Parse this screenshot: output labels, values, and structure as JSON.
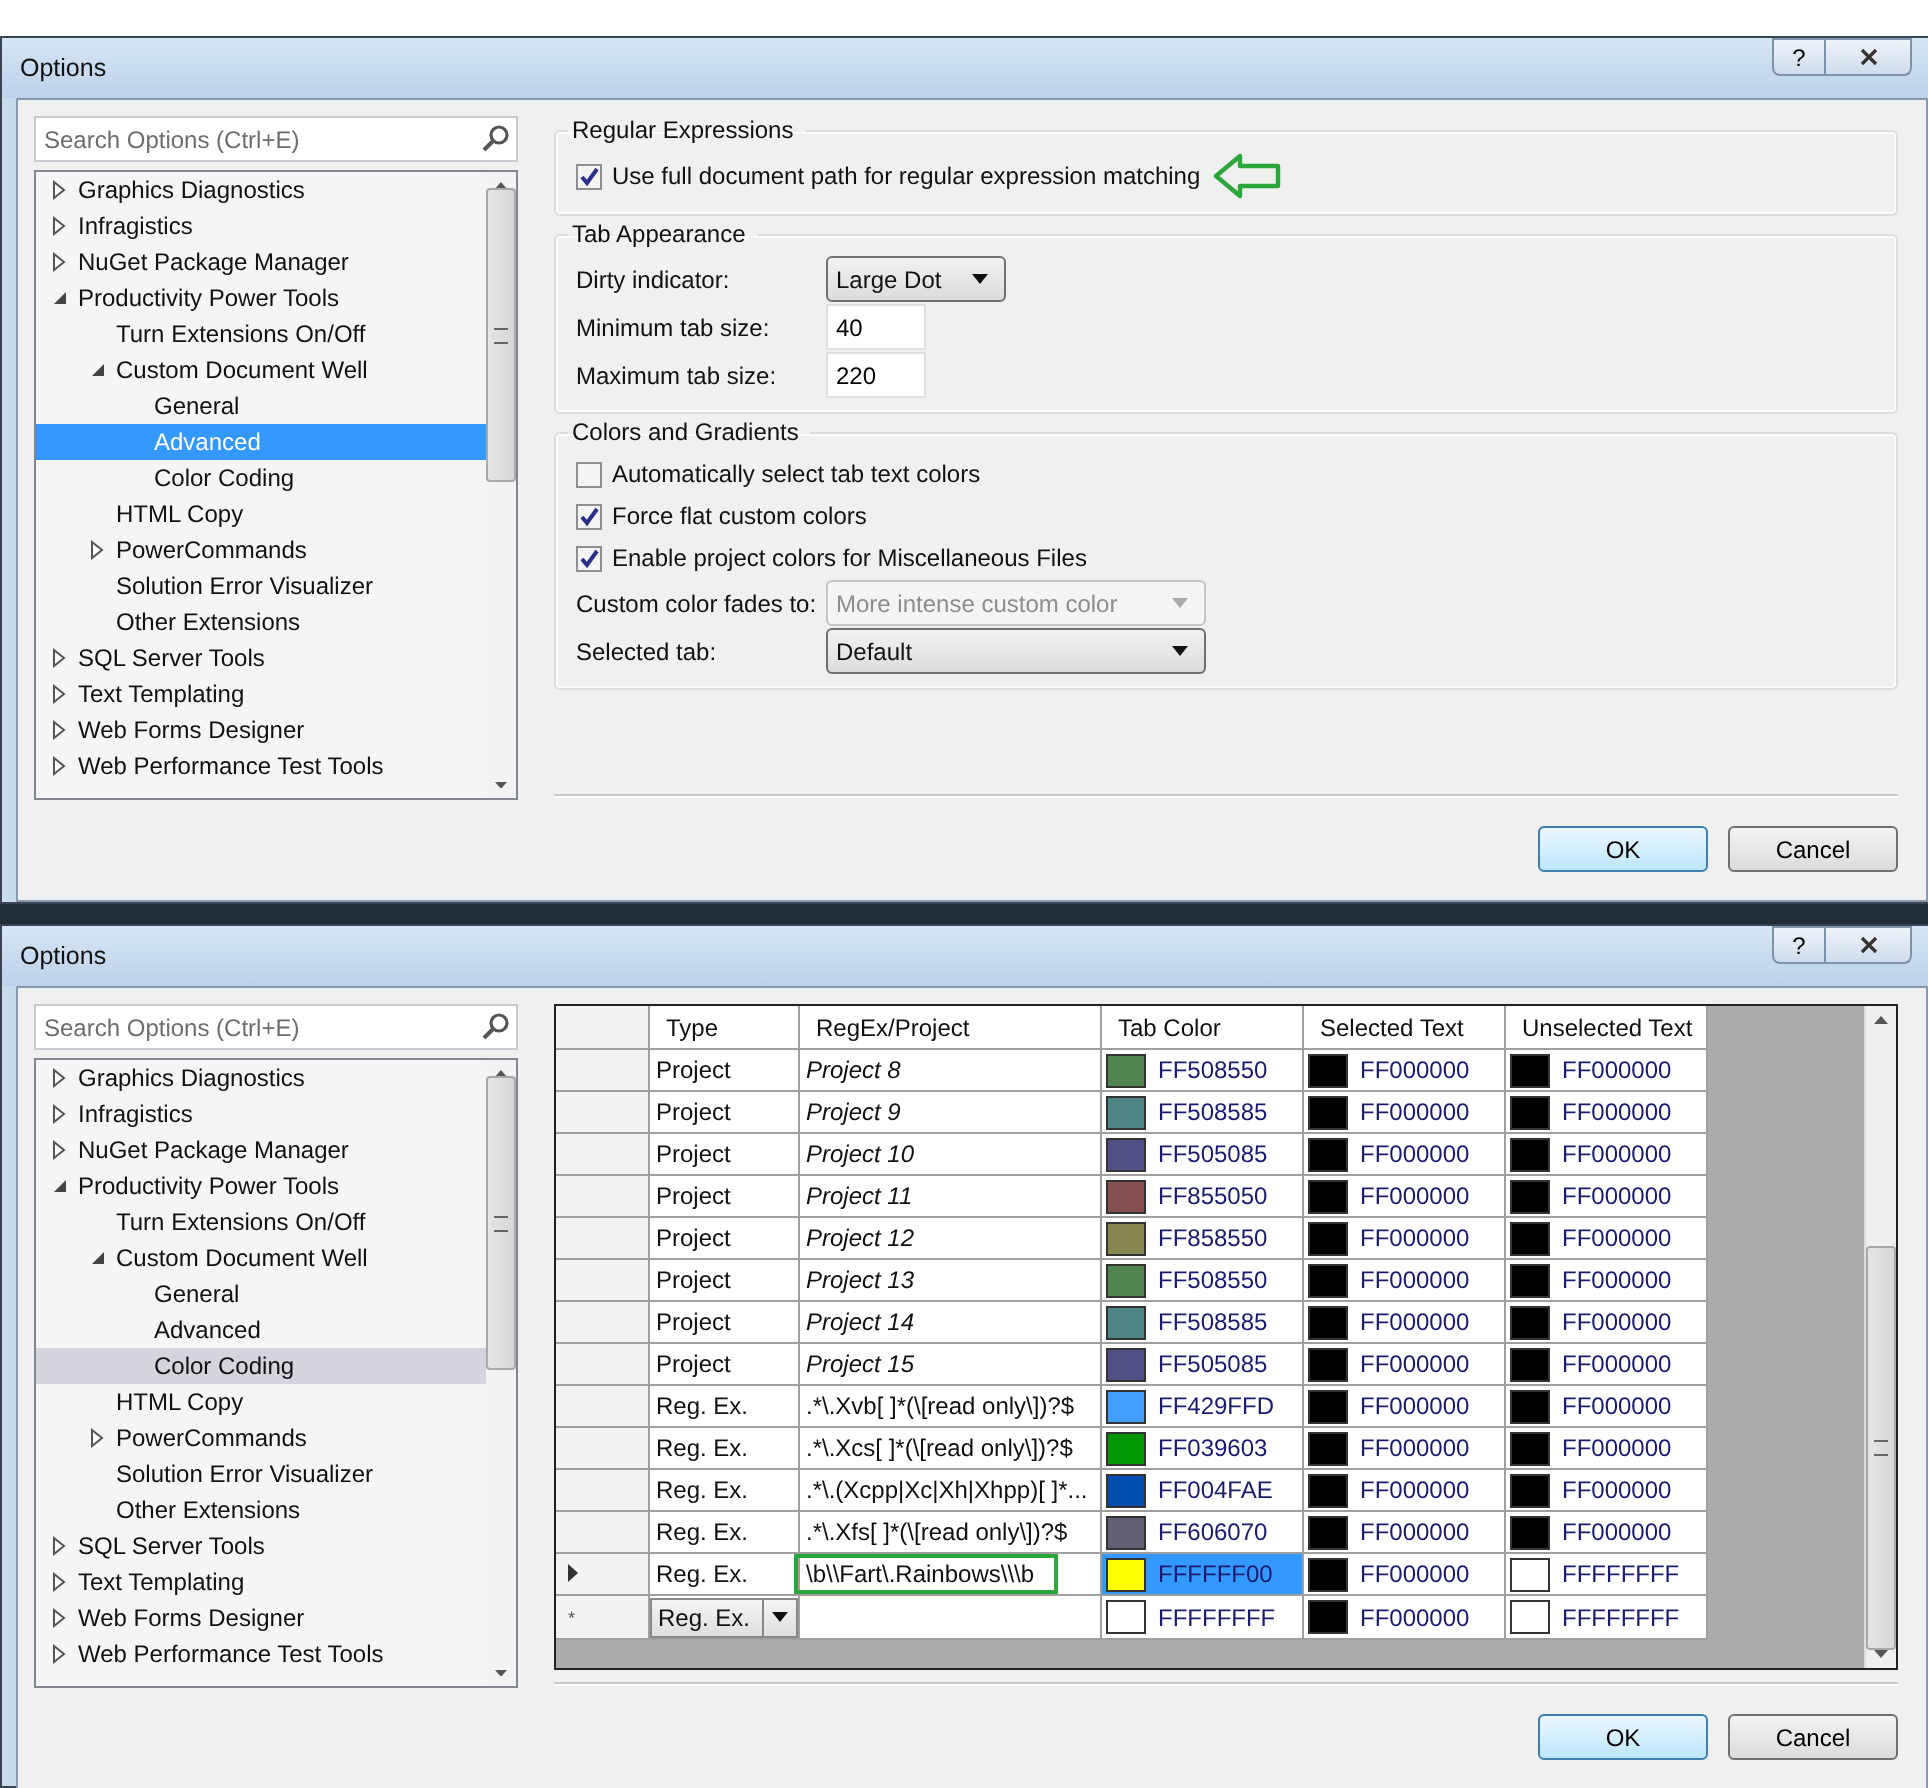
{
  "windows": [
    {
      "title": "Options",
      "help": "?",
      "search": {
        "placeholder": "Search Options (Ctrl+E)"
      },
      "tree_focused": true,
      "tree": [
        {
          "label": "Graphics Diagnostics",
          "expanded": false,
          "selected": false
        },
        {
          "label": "Infragistics",
          "expanded": false,
          "selected": false
        },
        {
          "label": "NuGet Package Manager",
          "expanded": false,
          "selected": false
        },
        {
          "label": "Productivity Power Tools",
          "expanded": true,
          "selected": false,
          "children": [
            {
              "label": "Turn Extensions On/Off",
              "selected": false
            },
            {
              "label": "Custom Document Well",
              "expanded": true,
              "selected": false,
              "children": [
                {
                  "label": "General",
                  "selected": false
                },
                {
                  "label": "Advanced",
                  "selected": true
                },
                {
                  "label": "Color Coding",
                  "selected": false
                }
              ]
            },
            {
              "label": "HTML Copy",
              "selected": false
            },
            {
              "label": "PowerCommands",
              "expanded": false,
              "selected": false
            },
            {
              "label": "Solution Error Visualizer",
              "selected": false
            },
            {
              "label": "Other Extensions",
              "selected": false
            }
          ]
        },
        {
          "label": "SQL Server Tools",
          "expanded": false,
          "selected": false
        },
        {
          "label": "Text Templating",
          "expanded": false,
          "selected": false
        },
        {
          "label": "Web Forms Designer",
          "expanded": false,
          "selected": false
        },
        {
          "label": "Web Performance Test Tools",
          "expanded": false,
          "selected": false
        }
      ],
      "page": {
        "kind": "form",
        "groups": [
          {
            "title": "Regular Expressions",
            "rows": [
              {
                "kind": "checkbox",
                "label": "Use full document path for regular expression matching",
                "checked": true,
                "highlighted": true
              }
            ]
          },
          {
            "title": "Tab Appearance",
            "rows": [
              {
                "kind": "dropdown",
                "label": "Dirty indicator:",
                "value": "Large Dot",
                "disabled": false,
                "highlighted": false
              },
              {
                "kind": "textbox",
                "label": "Minimum tab size:",
                "value": "40",
                "highlighted": false
              },
              {
                "kind": "textbox",
                "label": "Maximum tab size:",
                "value": "220",
                "highlighted": false
              }
            ]
          },
          {
            "title": "Colors and Gradients",
            "rows": [
              {
                "kind": "checkbox",
                "label": "Automatically select tab text colors",
                "checked": false,
                "highlighted": false
              },
              {
                "kind": "checkbox",
                "label": "Force flat custom colors",
                "checked": true,
                "highlighted": false
              },
              {
                "kind": "checkbox",
                "label": "Enable project colors for Miscellaneous Files",
                "checked": true,
                "highlighted": false
              },
              {
                "kind": "dropdown",
                "label": "Custom color fades to:",
                "value": "More intense custom color",
                "disabled": true,
                "highlighted": false
              },
              {
                "kind": "dropdown",
                "label": "Selected tab:",
                "value": "Default",
                "disabled": false,
                "highlighted": false
              }
            ]
          }
        ]
      },
      "buttons": [
        {
          "label": "OK",
          "default": true
        },
        {
          "label": "Cancel",
          "default": false
        }
      ]
    },
    {
      "title": "Options",
      "help": "?",
      "search": {
        "placeholder": "Search Options (Ctrl+E)"
      },
      "tree_focused": false,
      "tree": [
        {
          "label": "Graphics Diagnostics",
          "expanded": false,
          "selected": false
        },
        {
          "label": "Infragistics",
          "expanded": false,
          "selected": false
        },
        {
          "label": "NuGet Package Manager",
          "expanded": false,
          "selected": false
        },
        {
          "label": "Productivity Power Tools",
          "expanded": true,
          "selected": false,
          "children": [
            {
              "label": "Turn Extensions On/Off",
              "selected": false
            },
            {
              "label": "Custom Document Well",
              "expanded": true,
              "selected": false,
              "children": [
                {
                  "label": "General",
                  "selected": false
                },
                {
                  "label": "Advanced",
                  "selected": false
                },
                {
                  "label": "Color Coding",
                  "selected": true
                }
              ]
            },
            {
              "label": "HTML Copy",
              "selected": false
            },
            {
              "label": "PowerCommands",
              "expanded": false,
              "selected": false
            },
            {
              "label": "Solution Error Visualizer",
              "selected": false
            },
            {
              "label": "Other Extensions",
              "selected": false
            }
          ]
        },
        {
          "label": "SQL Server Tools",
          "expanded": false,
          "selected": false
        },
        {
          "label": "Text Templating",
          "expanded": false,
          "selected": false
        },
        {
          "label": "Web Forms Designer",
          "expanded": false,
          "selected": false
        },
        {
          "label": "Web Performance Test Tools",
          "expanded": false,
          "selected": false
        }
      ],
      "page": {
        "kind": "grid",
        "columns": [
          "Type",
          "RegEx/Project",
          "Tab Color",
          "Selected Text",
          "Unselected Text"
        ],
        "rows": [
          {
            "kind": "project",
            "type": "Project",
            "pattern": "Project 8",
            "tab": {
              "color": "#508550",
              "code": "FF508550"
            },
            "sel": {
              "color": "#000000",
              "code": "FF000000"
            },
            "unsel": {
              "color": "#000000",
              "code": "FF000000"
            },
            "current": false,
            "highlighted": false
          },
          {
            "kind": "project",
            "type": "Project",
            "pattern": "Project 9",
            "tab": {
              "color": "#508585",
              "code": "FF508585"
            },
            "sel": {
              "color": "#000000",
              "code": "FF000000"
            },
            "unsel": {
              "color": "#000000",
              "code": "FF000000"
            },
            "current": false,
            "highlighted": false
          },
          {
            "kind": "project",
            "type": "Project",
            "pattern": "Project 10",
            "tab": {
              "color": "#505085",
              "code": "FF505085"
            },
            "sel": {
              "color": "#000000",
              "code": "FF000000"
            },
            "unsel": {
              "color": "#000000",
              "code": "FF000000"
            },
            "current": false,
            "highlighted": false
          },
          {
            "kind": "project",
            "type": "Project",
            "pattern": "Project 11",
            "tab": {
              "color": "#855050",
              "code": "FF855050"
            },
            "sel": {
              "color": "#000000",
              "code": "FF000000"
            },
            "unsel": {
              "color": "#000000",
              "code": "FF000000"
            },
            "current": false,
            "highlighted": false
          },
          {
            "kind": "project",
            "type": "Project",
            "pattern": "Project 12",
            "tab": {
              "color": "#858550",
              "code": "FF858550"
            },
            "sel": {
              "color": "#000000",
              "code": "FF000000"
            },
            "unsel": {
              "color": "#000000",
              "code": "FF000000"
            },
            "current": false,
            "highlighted": false
          },
          {
            "kind": "project",
            "type": "Project",
            "pattern": "Project 13",
            "tab": {
              "color": "#508550",
              "code": "FF508550"
            },
            "sel": {
              "color": "#000000",
              "code": "FF000000"
            },
            "unsel": {
              "color": "#000000",
              "code": "FF000000"
            },
            "current": false,
            "highlighted": false
          },
          {
            "kind": "project",
            "type": "Project",
            "pattern": "Project 14",
            "tab": {
              "color": "#508585",
              "code": "FF508585"
            },
            "sel": {
              "color": "#000000",
              "code": "FF000000"
            },
            "unsel": {
              "color": "#000000",
              "code": "FF000000"
            },
            "current": false,
            "highlighted": false
          },
          {
            "kind": "project",
            "type": "Project",
            "pattern": "Project 15",
            "tab": {
              "color": "#505085",
              "code": "FF505085"
            },
            "sel": {
              "color": "#000000",
              "code": "FF000000"
            },
            "unsel": {
              "color": "#000000",
              "code": "FF000000"
            },
            "current": false,
            "highlighted": false
          },
          {
            "kind": "regex",
            "type": "Reg. Ex.",
            "pattern": ".*\\.Xvb[ ]*(\\[read only\\])?$",
            "tab": {
              "color": "#429ffd",
              "code": "FF429FFD"
            },
            "sel": {
              "color": "#000000",
              "code": "FF000000"
            },
            "unsel": {
              "color": "#000000",
              "code": "FF000000"
            },
            "current": false,
            "highlighted": false
          },
          {
            "kind": "regex",
            "type": "Reg. Ex.",
            "pattern": ".*\\.Xcs[ ]*(\\[read only\\])?$",
            "tab": {
              "color": "#039603",
              "code": "FF039603"
            },
            "sel": {
              "color": "#000000",
              "code": "FF000000"
            },
            "unsel": {
              "color": "#000000",
              "code": "FF000000"
            },
            "current": false,
            "highlighted": false
          },
          {
            "kind": "regex",
            "type": "Reg. Ex.",
            "pattern": ".*\\.(Xcpp|Xc|Xh|Xhpp)[ ]*...",
            "tab": {
              "color": "#004fae",
              "code": "FF004FAE"
            },
            "sel": {
              "color": "#000000",
              "code": "FF000000"
            },
            "unsel": {
              "color": "#000000",
              "code": "FF000000"
            },
            "current": false,
            "highlighted": false
          },
          {
            "kind": "regex",
            "type": "Reg. Ex.",
            "pattern": ".*\\.Xfs[ ]*(\\[read only\\])?$",
            "tab": {
              "color": "#606070",
              "code": "FF606070"
            },
            "sel": {
              "color": "#000000",
              "code": "FF000000"
            },
            "unsel": {
              "color": "#000000",
              "code": "FF000000"
            },
            "current": false,
            "highlighted": false
          },
          {
            "kind": "regex",
            "type": "Reg. Ex.",
            "pattern": "\\b\\\\Fart\\.Rainbows\\\\\\b",
            "tab": {
              "color": "#ffff00",
              "code": "FFFFFF00"
            },
            "sel": {
              "color": "#000000",
              "code": "FF000000"
            },
            "unsel": {
              "color": "#ffffff",
              "code": "FFFFFFFF"
            },
            "current": true,
            "highlighted": true
          },
          {
            "kind": "new",
            "marker": "*",
            "type": "Reg. Ex.",
            "tab": {
              "color": "#ffffff",
              "code": "FFFFFFFF"
            },
            "sel": {
              "color": "#000000",
              "code": "FF000000"
            },
            "unsel": {
              "color": "#ffffff",
              "code": "FFFFFFFF"
            },
            "current": false
          }
        ]
      },
      "buttons": [
        {
          "label": "OK",
          "default": true
        },
        {
          "label": "Cancel",
          "default": false
        }
      ]
    }
  ]
}
